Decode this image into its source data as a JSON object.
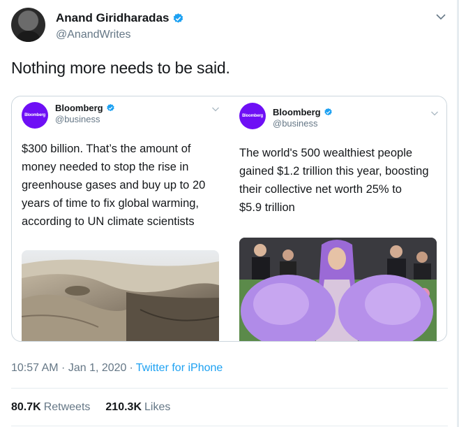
{
  "tweet": {
    "author_name": "Anand Giridharadas",
    "author_handle": "@AnandWrites",
    "text": "Nothing more needs to be said.",
    "timestamp": "10:57 AM · Jan 1, 2020",
    "separator": "·",
    "source": "Twitter for iPhone",
    "retweets_count": "80.7K",
    "retweets_label": "Retweets",
    "likes_count": "210.3K",
    "likes_label": "Likes"
  },
  "quoted": [
    {
      "logo_text": "Bloomberg",
      "name": "Bloomberg",
      "handle": "@business",
      "lines": [
        "$300 billion. That’s the amount of",
        "money needed to stop the rise in",
        "greenhouse gases and buy up to 20",
        "years of time to fix global warming,",
        "according to UN climate scientists"
      ]
    },
    {
      "logo_text": "Bloomberg",
      "name": "Bloomberg",
      "handle": "@business",
      "lines": [
        "The world's 500 wealthiest people",
        "gained $1.2 trillion this year, boosting",
        "their collective net worth 25% to",
        "$5.9 trillion"
      ]
    }
  ],
  "colors": {
    "accent": "#1da1f2",
    "bloomberg_purple": "#6e0ff5",
    "muted": "#657786"
  }
}
